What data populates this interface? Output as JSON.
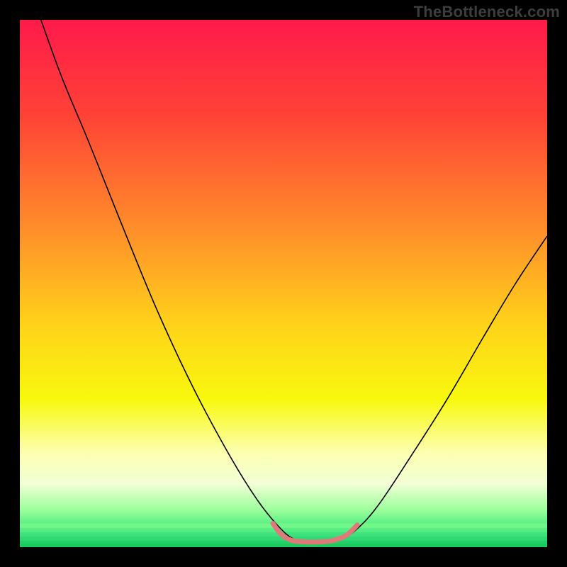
{
  "watermark": "TheBottleneck.com",
  "chart_data": {
    "type": "line",
    "title": "",
    "xlabel": "",
    "ylabel": "",
    "xlim": [
      0,
      100
    ],
    "ylim": [
      0,
      100
    ],
    "axes_visible": false,
    "grid": false,
    "legend": false,
    "background_gradient": {
      "type": "vertical",
      "stops": [
        {
          "offset": 0.0,
          "color": "#ff1a4b"
        },
        {
          "offset": 0.18,
          "color": "#ff4236"
        },
        {
          "offset": 0.4,
          "color": "#ff8f2a"
        },
        {
          "offset": 0.58,
          "color": "#ffd31a"
        },
        {
          "offset": 0.72,
          "color": "#f8f80e"
        },
        {
          "offset": 0.82,
          "color": "#fdffb0"
        },
        {
          "offset": 0.88,
          "color": "#f2ffd6"
        },
        {
          "offset": 0.93,
          "color": "#9bff9b"
        },
        {
          "offset": 0.97,
          "color": "#35e87a"
        },
        {
          "offset": 1.0,
          "color": "#18c85c"
        }
      ],
      "green_bands": [
        {
          "y": 95.5,
          "color": "#8cff8c"
        },
        {
          "y": 96.4,
          "color": "#6bf08c"
        },
        {
          "y": 97.2,
          "color": "#4be082"
        },
        {
          "y": 98.0,
          "color": "#35d878"
        },
        {
          "y": 98.8,
          "color": "#22cc6c"
        },
        {
          "y": 99.4,
          "color": "#18c85c"
        }
      ]
    },
    "series": [
      {
        "name": "bottleneck-curve",
        "color": "#000000",
        "width": 1.6,
        "points": [
          {
            "x": 4.0,
            "y": 0.0
          },
          {
            "x": 8.0,
            "y": 11.0
          },
          {
            "x": 13.0,
            "y": 23.0
          },
          {
            "x": 19.0,
            "y": 38.0
          },
          {
            "x": 26.0,
            "y": 55.0
          },
          {
            "x": 33.0,
            "y": 70.0
          },
          {
            "x": 40.0,
            "y": 83.0
          },
          {
            "x": 45.0,
            "y": 91.0
          },
          {
            "x": 49.0,
            "y": 96.0
          },
          {
            "x": 52.0,
            "y": 98.5
          },
          {
            "x": 55.0,
            "y": 99.0
          },
          {
            "x": 58.0,
            "y": 99.0
          },
          {
            "x": 61.0,
            "y": 98.5
          },
          {
            "x": 64.0,
            "y": 96.5
          },
          {
            "x": 68.0,
            "y": 92.0
          },
          {
            "x": 74.0,
            "y": 83.0
          },
          {
            "x": 81.0,
            "y": 72.0
          },
          {
            "x": 88.0,
            "y": 60.0
          },
          {
            "x": 94.0,
            "y": 50.0
          },
          {
            "x": 100.0,
            "y": 41.0
          }
        ]
      },
      {
        "name": "bottom-highlight",
        "color": "#e07a7a",
        "width": 7,
        "linecap": "round",
        "points": [
          {
            "x": 48.0,
            "y": 95.5
          },
          {
            "x": 49.5,
            "y": 97.5
          },
          {
            "x": 51.5,
            "y": 98.7
          },
          {
            "x": 54.0,
            "y": 99.0
          },
          {
            "x": 57.0,
            "y": 99.0
          },
          {
            "x": 59.5,
            "y": 98.7
          },
          {
            "x": 62.0,
            "y": 97.7
          },
          {
            "x": 64.0,
            "y": 95.8
          }
        ]
      }
    ]
  }
}
